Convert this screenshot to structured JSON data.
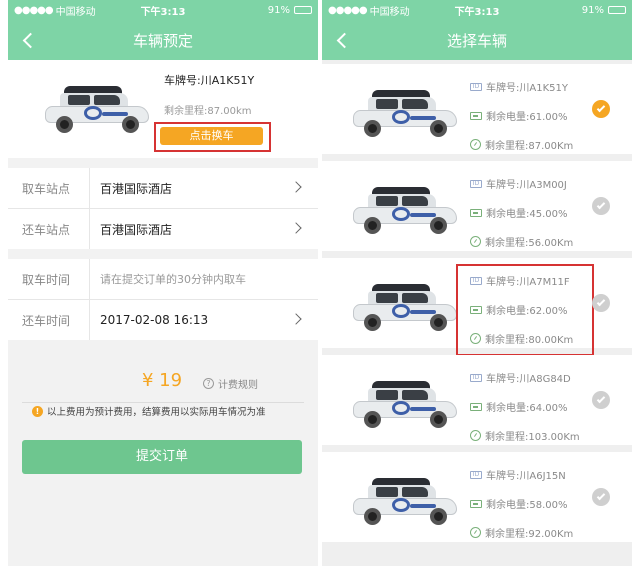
{
  "status_left": {
    "carrier": "中国移动",
    "time": "下午3:13",
    "battery": "91%"
  },
  "status_right": {
    "carrier": "中国移动",
    "time": "下午3:13",
    "battery": "91%"
  },
  "booking": {
    "title": "车辆预定",
    "plate": "车牌号:川A1K51Y",
    "remaining": "剩余里程:87.00km",
    "change_button": "点击换车",
    "pickup_station_label": "取车站点",
    "pickup_station_value": "百港国际酒店",
    "return_station_label": "还车站点",
    "return_station_value": "百港国际酒店",
    "pickup_time_label": "取车时间",
    "pickup_time_value": "请在提交订单的30分钟内取车",
    "return_time_label": "还车时间",
    "return_time_value": "2017-02-08   16:13",
    "price": "¥ 19",
    "pricing_rule": "计费规则",
    "notice": "以上费用为预计费用，结算费用以实际用车情况为准",
    "submit": "提交订单"
  },
  "select": {
    "title": "选择车辆",
    "cars": [
      {
        "plate": "车牌号:川A1K51Y",
        "battery": "剩余电量:61.00%",
        "mileage": "剩余里程:87.00Km",
        "selected": true
      },
      {
        "plate": "车牌号:川A3M00J",
        "battery": "剩余电量:45.00%",
        "mileage": "剩余里程:56.00Km",
        "selected": false
      },
      {
        "plate": "车牌号:川A7M11F",
        "battery": "剩余电量:62.00%",
        "mileage": "剩余里程:80.00Km",
        "selected": false
      },
      {
        "plate": "车牌号:川A8G84D",
        "battery": "剩余电量:64.00%",
        "mileage": "剩余里程:103.00Km",
        "selected": false
      },
      {
        "plate": "车牌号:川A6J15N",
        "battery": "剩余电量:58.00%",
        "mileage": "剩余里程:92.00Km",
        "selected": false
      }
    ]
  },
  "colors": {
    "primary_green": "#7ed4a6",
    "accent_orange": "#f5a623",
    "highlight_red": "#d63333"
  }
}
